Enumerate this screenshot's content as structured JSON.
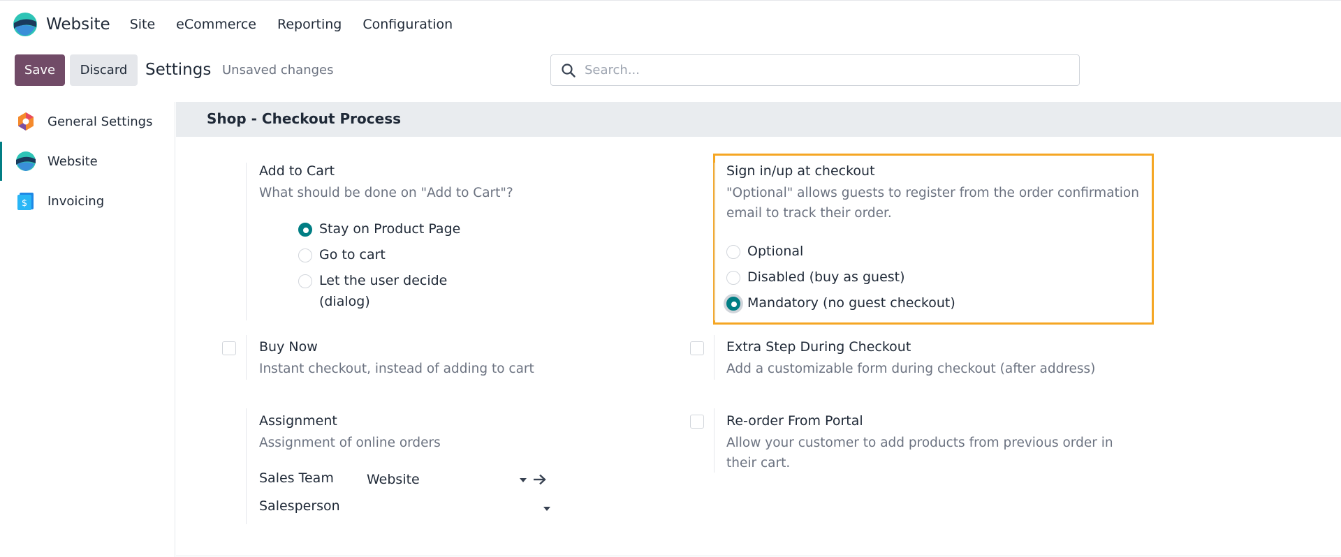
{
  "navbar": {
    "app_name": "Website",
    "menu": [
      "Site",
      "eCommerce",
      "Reporting",
      "Configuration"
    ]
  },
  "control": {
    "save_label": "Save",
    "discard_label": "Discard",
    "title": "Settings",
    "status": "Unsaved changes",
    "search_placeholder": "Search..."
  },
  "sidebar": {
    "items": [
      {
        "label": "General Settings",
        "icon": "general-settings-icon",
        "active": false
      },
      {
        "label": "Website",
        "icon": "website-app-icon",
        "active": true
      },
      {
        "label": "Invoicing",
        "icon": "invoicing-icon",
        "active": false
      }
    ]
  },
  "section": {
    "title": "Shop - Checkout Process"
  },
  "add_to_cart": {
    "title": "Add to Cart",
    "description": "What should be done on \"Add to Cart\"?",
    "options": [
      {
        "label": "Stay on Product Page",
        "checked": true
      },
      {
        "label": "Go to cart",
        "checked": false
      },
      {
        "label": "Let the user decide",
        "label2": "(dialog)",
        "checked": false
      }
    ]
  },
  "sign_in": {
    "title": "Sign in/up at checkout",
    "description_line1": "\"Optional\" allows guests to register from the order confirmation",
    "description_line2": "email to track their order.",
    "options": [
      {
        "label": "Optional",
        "checked": false
      },
      {
        "label": "Disabled (buy as guest)",
        "checked": false
      },
      {
        "label": "Mandatory (no guest checkout)",
        "checked": true
      }
    ]
  },
  "buy_now": {
    "title": "Buy Now",
    "description": "Instant checkout, instead of adding to cart",
    "checked": false
  },
  "extra_step": {
    "title": "Extra Step During Checkout",
    "description": "Add a customizable form during checkout (after address)",
    "checked": false
  },
  "assignment": {
    "title": "Assignment",
    "description": "Assignment of online orders",
    "sales_team_label": "Sales Team",
    "sales_team_value": "Website",
    "salesperson_label": "Salesperson",
    "salesperson_value": ""
  },
  "reorder": {
    "title": "Re-order From Portal",
    "description_line1": "Allow your customer to add products from previous order in",
    "description_line2": "their cart.",
    "checked": false
  },
  "colors": {
    "primary": "#714b67",
    "accent": "#017e84",
    "highlight": "#f5a623"
  }
}
